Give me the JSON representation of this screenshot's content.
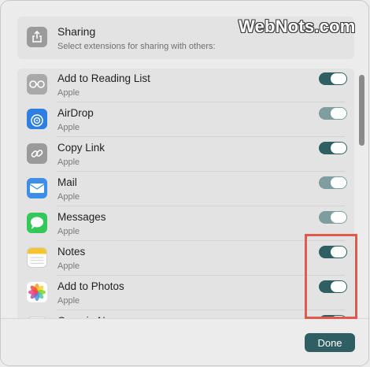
{
  "header": {
    "title": "Sharing",
    "subtitle": "Select extensions for sharing with others:",
    "icon": "share-icon"
  },
  "watermark": "WebNots.com",
  "extensions": [
    {
      "name": "Add to Reading List",
      "vendor": "Apple",
      "icon": "reading-list-icon",
      "enabled": true
    },
    {
      "name": "AirDrop",
      "vendor": "Apple",
      "icon": "airdrop-icon",
      "enabled": true,
      "dimmed": true
    },
    {
      "name": "Copy Link",
      "vendor": "Apple",
      "icon": "link-icon",
      "enabled": true
    },
    {
      "name": "Mail",
      "vendor": "Apple",
      "icon": "mail-icon",
      "enabled": true,
      "dimmed": true
    },
    {
      "name": "Messages",
      "vendor": "Apple",
      "icon": "messages-icon",
      "enabled": true,
      "dimmed": true
    },
    {
      "name": "Notes",
      "vendor": "Apple",
      "icon": "notes-icon",
      "enabled": true
    },
    {
      "name": "Add to Photos",
      "vendor": "Apple",
      "icon": "photos-icon",
      "enabled": true
    },
    {
      "name": "Open in N...",
      "vendor": "",
      "icon": "doc-icon",
      "enabled": true
    }
  ],
  "footer": {
    "done_label": "Done"
  },
  "colors": {
    "accent": "#2f5f62",
    "accent_dimmed": "#7e9d9e",
    "highlight": "#e4584b"
  }
}
